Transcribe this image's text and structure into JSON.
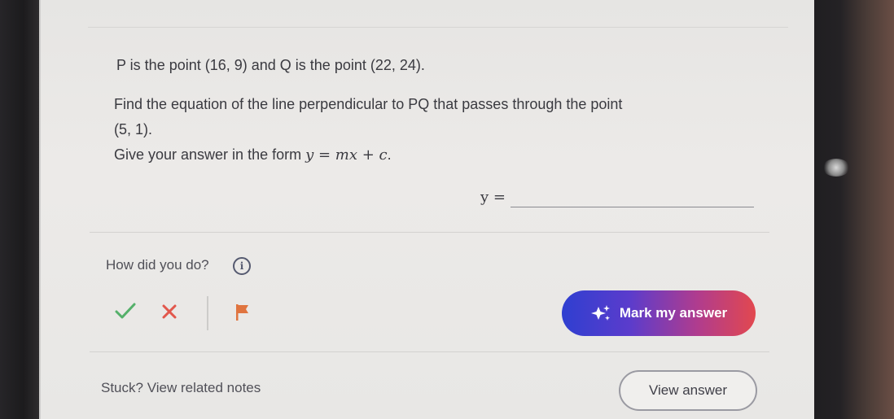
{
  "question": {
    "line1": "P is the point (16, 9) and Q is the point (22, 24).",
    "line2": "Find the equation of the line perpendicular to PQ that passes through the point",
    "line3": "(5, 1).",
    "line4_prefix": "Give your answer in the form ",
    "line4_math": "y = mx + c",
    "line4_suffix": "."
  },
  "answer": {
    "label": "y =",
    "value": "",
    "placeholder": ""
  },
  "feedback": {
    "how_label": "How did you do?",
    "info_icon": "i",
    "icons": [
      "check-icon",
      "cross-icon",
      "flag-icon",
      "info-icon",
      "sparkle-icon"
    ]
  },
  "actions": {
    "mark_button_label": "Mark my answer",
    "stuck_link": "Stuck? View related notes",
    "view_answer_label": "View answer"
  },
  "colors": {
    "check": "#55b06a",
    "cross": "#e2574c",
    "flag": "#e0743f",
    "mark_gradient_start": "#2f3fd0",
    "mark_gradient_end": "#e2484f"
  }
}
